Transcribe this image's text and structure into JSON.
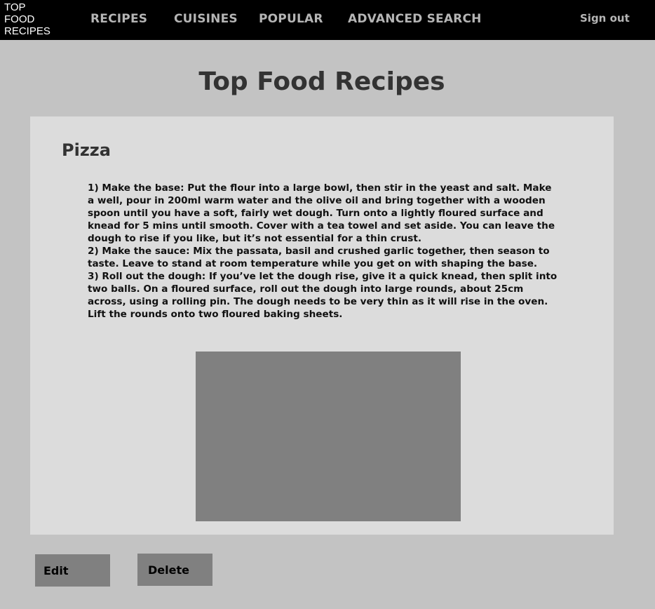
{
  "header": {
    "logo_lines": [
      "TOP",
      "FOOD",
      "RECIPES"
    ],
    "nav": [
      "RECIPES",
      "CUISINES",
      "POPULAR",
      "ADVANCED SEARCH"
    ],
    "sign_out": "Sign out"
  },
  "main": {
    "page_title": "Top Food Recipes",
    "recipe": {
      "title": "Pizza",
      "steps": [
        "1) Make the base: Put the flour into a large bowl, then stir in the yeast and salt. Make a well, pour in 200ml warm water and the olive oil and bring together with a wooden spoon until you have a soft, fairly wet dough. Turn onto a lightly floured surface and knead for 5 mins until smooth. Cover with a tea towel and set aside. You can leave the dough to rise if you like, but it’s not essential for a thin crust.",
        "2) Make the sauce: Mix the passata, basil and crushed garlic together, then season to taste. Leave to stand at room temperature while you get on with shaping the base.",
        "3) Roll out the dough: If you’ve let the dough rise, give it a quick knead, then split into two balls. On a floured surface, roll out the dough into large rounds, about 25cm across, using a rolling pin. The dough needs to be very thin as it will rise in the oven. Lift the rounds onto two floured baking sheets."
      ]
    }
  },
  "actions": {
    "edit_label": "Edit",
    "delete_label": "Delete"
  },
  "colors": {
    "topbar": "#000000",
    "page_background": "#c3c3c3",
    "card_background": "#dcdcdc",
    "image_placeholder": "#808080",
    "button_background": "#808080",
    "nav_text": "#b5b5b5"
  }
}
